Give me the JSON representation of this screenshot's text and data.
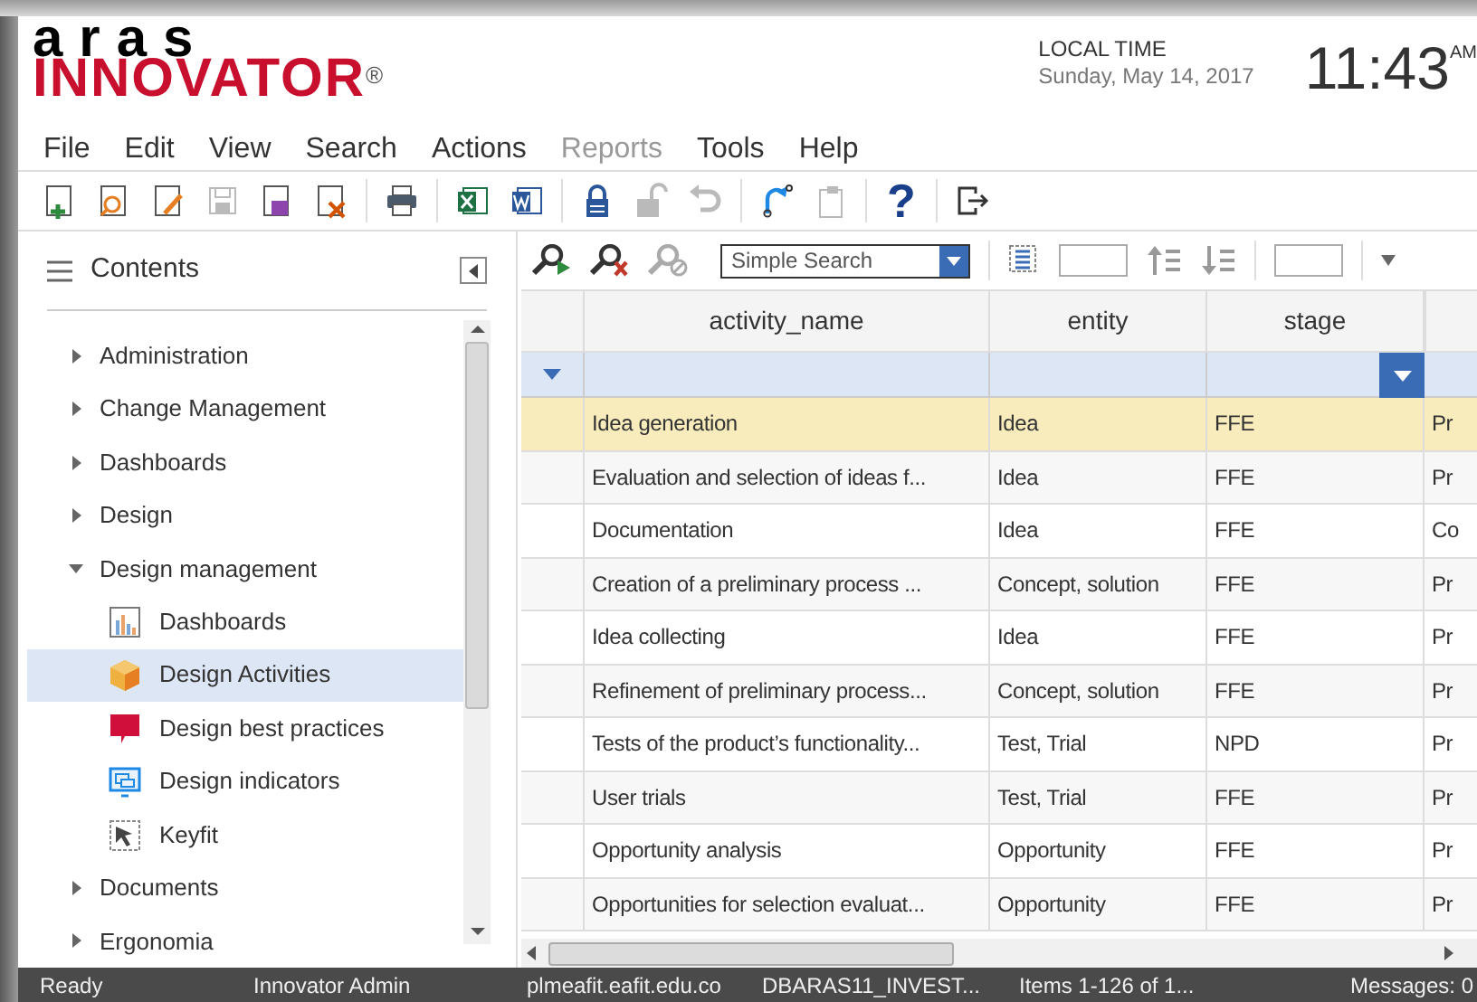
{
  "logo": {
    "top": "aras",
    "main": "INNOVATOR",
    "mark": "®"
  },
  "clock": {
    "label": "LOCAL TIME",
    "date": "Sunday, May 14, 2017",
    "time": "11:43",
    "suffix": "AM"
  },
  "menu": [
    {
      "label": "File",
      "disabled": false
    },
    {
      "label": "Edit",
      "disabled": false
    },
    {
      "label": "View",
      "disabled": false
    },
    {
      "label": "Search",
      "disabled": false
    },
    {
      "label": "Actions",
      "disabled": false
    },
    {
      "label": "Reports",
      "disabled": true
    },
    {
      "label": "Tools",
      "disabled": false
    },
    {
      "label": "Help",
      "disabled": false
    }
  ],
  "toolbar": [
    {
      "kind": "new",
      "disabled": false
    },
    {
      "kind": "open",
      "disabled": false
    },
    {
      "kind": "edit",
      "disabled": false
    },
    {
      "kind": "save",
      "disabled": true
    },
    {
      "kind": "saveclose",
      "disabled": false
    },
    {
      "kind": "delete",
      "disabled": false
    },
    {
      "kind": "sep"
    },
    {
      "kind": "print",
      "disabled": false
    },
    {
      "kind": "sep"
    },
    {
      "kind": "excel",
      "disabled": false
    },
    {
      "kind": "word",
      "disabled": false
    },
    {
      "kind": "sep"
    },
    {
      "kind": "lock",
      "disabled": false
    },
    {
      "kind": "unlock",
      "disabled": true
    },
    {
      "kind": "undo",
      "disabled": true
    },
    {
      "kind": "sep"
    },
    {
      "kind": "promote",
      "disabled": false
    },
    {
      "kind": "paste",
      "disabled": true
    },
    {
      "kind": "sep"
    },
    {
      "kind": "help",
      "label": "?",
      "disabled": false
    },
    {
      "kind": "sep"
    },
    {
      "kind": "exit",
      "disabled": false
    }
  ],
  "sidebar": {
    "title": "Contents",
    "items": [
      {
        "label": "Administration",
        "expanded": false,
        "selected": false
      },
      {
        "label": "Change Management",
        "expanded": false,
        "selected": false
      },
      {
        "label": "Dashboards",
        "expanded": false,
        "selected": false
      },
      {
        "label": "Design",
        "expanded": false,
        "selected": false
      },
      {
        "label": "Design management",
        "expanded": true,
        "selected": false,
        "children": [
          {
            "label": "Dashboards",
            "kind": "chart",
            "selected": false
          },
          {
            "label": "Design Activities",
            "kind": "box",
            "selected": true
          },
          {
            "label": "Design best practices",
            "kind": "speech",
            "selected": false
          },
          {
            "label": "Design indicators",
            "kind": "monitor",
            "selected": false
          },
          {
            "label": "Keyfit",
            "kind": "cursor",
            "selected": false
          }
        ]
      },
      {
        "label": "Documents",
        "expanded": false,
        "selected": false
      },
      {
        "label": "Ergonomia",
        "expanded": false,
        "selected": false
      }
    ]
  },
  "search": {
    "mode": "Simple Search"
  },
  "table": {
    "columns": [
      "activity_name",
      "entity",
      "stage"
    ],
    "rows": [
      {
        "cells": [
          "Idea generation",
          "Idea",
          "FFE",
          "Pr"
        ],
        "selected": true
      },
      {
        "cells": [
          "Evaluation and selection of ideas f...",
          "Idea",
          "FFE",
          "Pr"
        ],
        "selected": false
      },
      {
        "cells": [
          "Documentation",
          "Idea",
          "FFE",
          "Co"
        ],
        "selected": false
      },
      {
        "cells": [
          "Creation of a preliminary process ...",
          "Concept, solution",
          "FFE",
          "Pr"
        ],
        "selected": false
      },
      {
        "cells": [
          "Idea collecting",
          "Idea",
          "FFE",
          "Pr"
        ],
        "selected": false
      },
      {
        "cells": [
          "Refinement of preliminary process...",
          "Concept, solution",
          "FFE",
          "Pr"
        ],
        "selected": false
      },
      {
        "cells": [
          "Tests of the product’s functionality...",
          "Test, Trial",
          "NPD",
          "Pr"
        ],
        "selected": false
      },
      {
        "cells": [
          "User trials",
          "Test, Trial",
          "FFE",
          "Pr"
        ],
        "selected": false
      },
      {
        "cells": [
          "Opportunity analysis",
          "Opportunity",
          "FFE",
          "Pr"
        ],
        "selected": false
      },
      {
        "cells": [
          "Opportunities for selection evaluat...",
          "Opportunity",
          "FFE",
          "Pr"
        ],
        "selected": false
      }
    ]
  },
  "status_bar": [
    "Ready",
    "Innovator Admin",
    "plmeafit.eafit.edu.co",
    "DBARAS11_INVEST...",
    "Items 1-126 of 1...",
    "Messages: 0"
  ]
}
